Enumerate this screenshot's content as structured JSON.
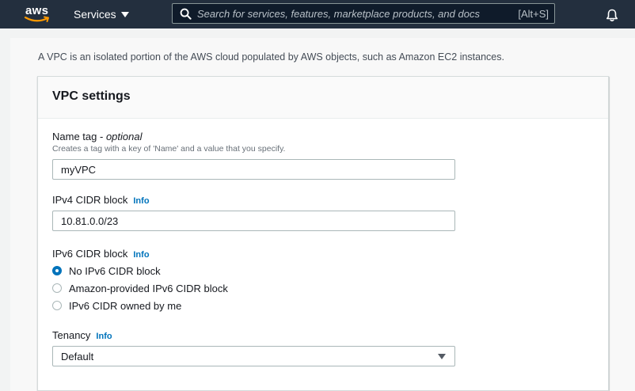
{
  "nav": {
    "logo_text": "aws",
    "services_label": "Services",
    "search_placeholder": "Search for services, features, marketplace products, and docs",
    "search_shortcut": "[Alt+S]"
  },
  "intro": "A VPC is an isolated portion of the AWS cloud populated by AWS objects, such as Amazon EC2 instances.",
  "panel": {
    "title": "VPC settings",
    "name_tag": {
      "label": "Name tag",
      "optional": "optional",
      "description": "Creates a tag with a key of 'Name' and a value that you specify.",
      "value": "myVPC"
    },
    "ipv4": {
      "label": "IPv4 CIDR block",
      "info": "Info",
      "value": "10.81.0.0/23"
    },
    "ipv6": {
      "label": "IPv6 CIDR block",
      "info": "Info",
      "options": [
        {
          "label": "No IPv6 CIDR block",
          "selected": true
        },
        {
          "label": "Amazon-provided IPv6 CIDR block",
          "selected": false
        },
        {
          "label": "IPv6 CIDR owned by me",
          "selected": false
        }
      ]
    },
    "tenancy": {
      "label": "Tenancy",
      "info": "Info",
      "value": "Default"
    }
  },
  "colors": {
    "nav_bg": "#232f3e",
    "accent": "#0073bb",
    "logo_smile": "#ff9900"
  }
}
